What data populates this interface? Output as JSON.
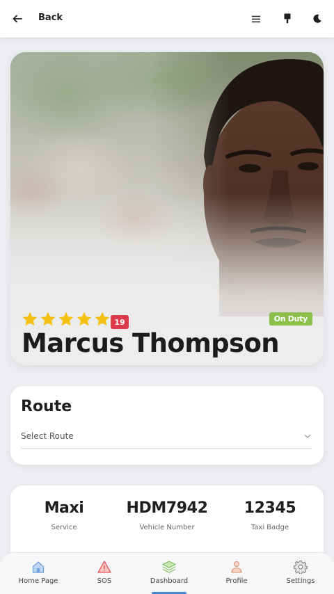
{
  "header": {
    "back_label": "Back",
    "icons": [
      "arrow-left-icon",
      "menu-icon",
      "paint-brush-icon",
      "moon-icon"
    ]
  },
  "driver": {
    "name": "Marcus Thompson",
    "rating_stars": 5,
    "rating_count": "19",
    "status": "On Duty",
    "colors": {
      "star": "#f5c114",
      "rating_badge": "#dc3a4a",
      "status_badge": "#8cc04b"
    }
  },
  "route": {
    "title": "Route",
    "select_placeholder": "Select Route"
  },
  "info": [
    {
      "value": "Maxi",
      "label": "Service"
    },
    {
      "value": "HDM7942",
      "label": "Vehicle Number"
    },
    {
      "value": "12345",
      "label": "Taxi Badge"
    }
  ],
  "nav": {
    "items": [
      {
        "label": "Home Page",
        "icon": "home-icon"
      },
      {
        "label": "SOS",
        "icon": "warning-icon"
      },
      {
        "label": "Dashboard",
        "icon": "layers-icon"
      },
      {
        "label": "Profile",
        "icon": "person-icon"
      },
      {
        "label": "Settings",
        "icon": "gear-icon"
      }
    ],
    "active": "Dashboard",
    "active_color": "#4a86d8"
  }
}
